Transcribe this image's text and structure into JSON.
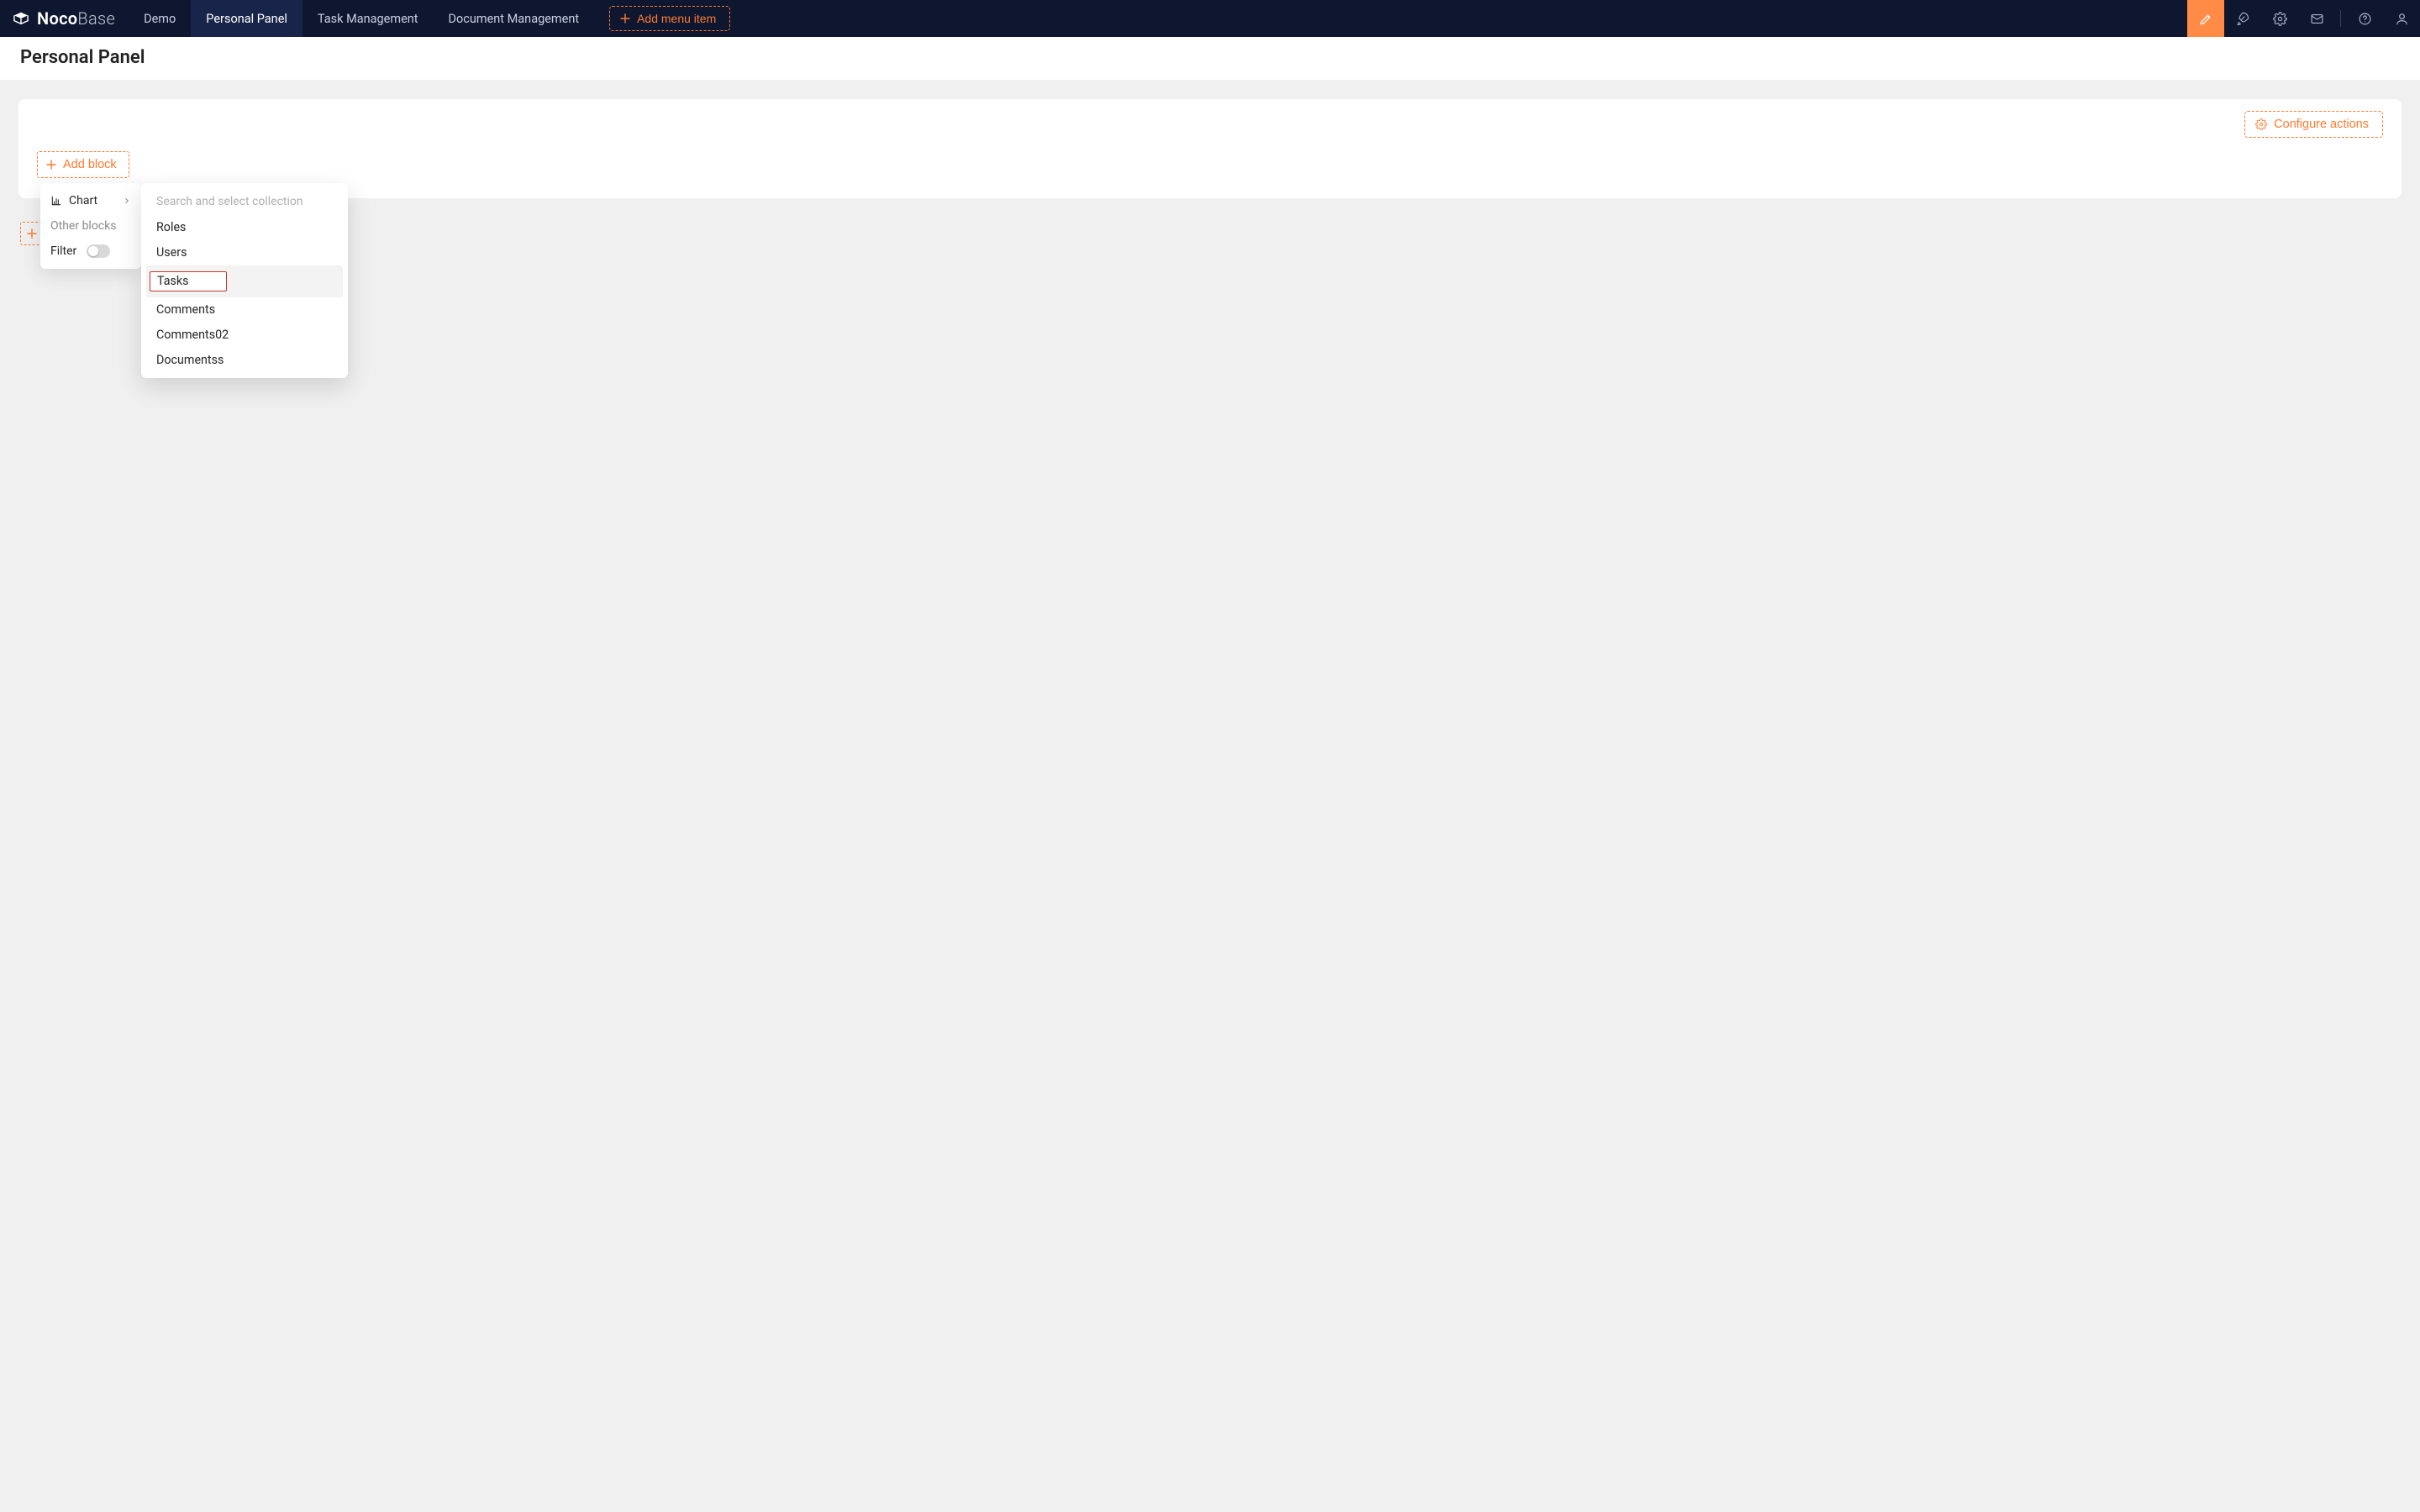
{
  "brand": {
    "name_bold": "Noco",
    "name_light": "Base"
  },
  "nav": {
    "items": [
      {
        "label": "Demo",
        "active": false
      },
      {
        "label": "Personal Panel",
        "active": true
      },
      {
        "label": "Task Management",
        "active": false
      },
      {
        "label": "Document Management",
        "active": false
      }
    ],
    "add_menu_label": "Add menu item"
  },
  "page": {
    "title": "Personal Panel"
  },
  "card": {
    "configure_actions_label": "Configure actions",
    "add_block_label": "Add block"
  },
  "menu1": {
    "chart_label": "Chart",
    "other_blocks_label": "Other blocks",
    "filter_label": "Filter"
  },
  "menu2": {
    "search_placeholder": "Search and select collection",
    "items": [
      {
        "label": "Roles"
      },
      {
        "label": "Users"
      },
      {
        "label": "Tasks",
        "highlighted": true
      },
      {
        "label": "Comments"
      },
      {
        "label": "Comments02"
      },
      {
        "label": "Documentss"
      }
    ]
  },
  "icons": {
    "design": "design-icon",
    "rocket": "rocket-icon",
    "settings": "gear-icon",
    "mail": "mail-icon",
    "help": "help-icon",
    "user": "user-icon"
  }
}
